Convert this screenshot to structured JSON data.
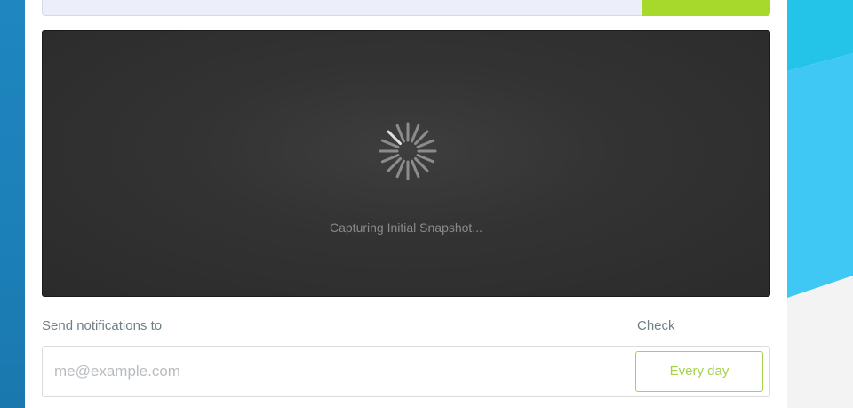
{
  "preview": {
    "status_text": "Capturing Initial Snapshot..."
  },
  "notifications": {
    "label": "Send notifications to",
    "email_placeholder": "me@example.com",
    "email_value": ""
  },
  "frequency": {
    "label": "Check",
    "selected": "Every day"
  },
  "colors": {
    "accent_green": "#a6d92b",
    "left_band_blue": "#1f86bf",
    "right_band_cyan": "#29c6ea",
    "preview_dark": "#2b2b2b"
  },
  "icons": {
    "spinner": "loading-spinner-icon"
  }
}
